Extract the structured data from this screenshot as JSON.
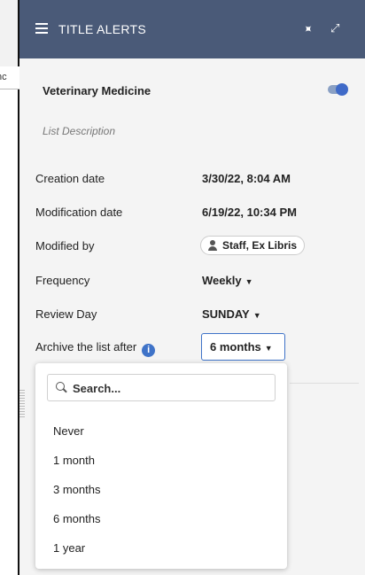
{
  "background_tab": {
    "partial_label": "nc"
  },
  "header": {
    "title": "TITLE ALERTS",
    "menu_icon": "hamburger-icon",
    "pin_icon": "pin-icon",
    "expand_icon": "expand-icon",
    "color": "#4a5a78"
  },
  "list": {
    "name": "Veterinary Medicine",
    "description": "List Description",
    "active": true
  },
  "fields": {
    "creation_date": {
      "label": "Creation date",
      "value": "3/30/22, 8:04 AM"
    },
    "modification_date": {
      "label": "Modification date",
      "value": "6/19/22, 10:34 PM"
    },
    "modified_by": {
      "label": "Modified by",
      "value": "Staff, Ex Libris"
    },
    "frequency": {
      "label": "Frequency",
      "value": "Weekly"
    },
    "review_day": {
      "label": "Review Day",
      "value": "SUNDAY"
    },
    "archive": {
      "label": "Archive the list after",
      "value": "6 months"
    }
  },
  "dropdown": {
    "search_placeholder": "Search...",
    "options": [
      "Never",
      "1 month",
      "3 months",
      "6 months",
      "1 year"
    ]
  },
  "colors": {
    "accent": "#3f73c8",
    "toggle": "#3f6ac8"
  }
}
